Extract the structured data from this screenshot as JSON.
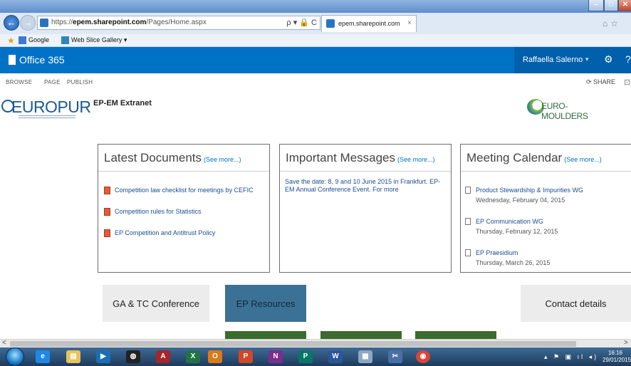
{
  "browser": {
    "url_prefix": "https://",
    "url_domain": "epem.sharepoint.com",
    "url_path": "/Pages/Home.aspx",
    "url_tools": "ρ ▾ 🔒 C",
    "tab_label": "epem.sharepoint.com",
    "tab_close": "×",
    "favorites": [
      "Google",
      "Web Slice Gallery ▾"
    ]
  },
  "suite": {
    "brand": "Office 365",
    "user": "Raffaella Salerno",
    "caret": "▾",
    "gear": "⚙",
    "help": "?"
  },
  "ribbon": {
    "tabs": [
      "BROWSE",
      "PAGE",
      "PUBLISH"
    ],
    "share": "SHARE"
  },
  "site": {
    "logo_text": "EUROPUR",
    "title": "EP-EM Extranet",
    "partner_logo_text": "EURO-MOULDERS"
  },
  "panels": {
    "documents": {
      "title": "Latest Documents",
      "more": "(See more...)",
      "items": [
        "Competition law checklist for meetings by CEFIC",
        "Competition rules for Statistics",
        "EP Competition and Antitrust Policy"
      ]
    },
    "messages": {
      "title": "Important Messages",
      "more": "(See more...)",
      "text": "Save the date: 8, 9 and 10 June 2015 in Frankfurt. EP-EM Annual Conference Event. For more"
    },
    "calendar": {
      "title": "Meeting Calendar",
      "more": "(See more...)",
      "items": [
        {
          "name": "Product Stewardship & Impurities WG",
          "date": "Wednesday, February 04, 2015"
        },
        {
          "name": "EP Communication WG",
          "date": "Thursday, February 12, 2015"
        },
        {
          "name": "EP Praesidium",
          "date": "Thursday, March 26, 2015"
        }
      ]
    }
  },
  "tiles": {
    "ga_tc": "GA & TC Conference",
    "resources": "EP Resources",
    "contact": "Contact details"
  },
  "scrollbar": {
    "left": "<",
    "right": ">"
  },
  "taskbar": {
    "time": "16:16",
    "date": "29/01/2015"
  }
}
